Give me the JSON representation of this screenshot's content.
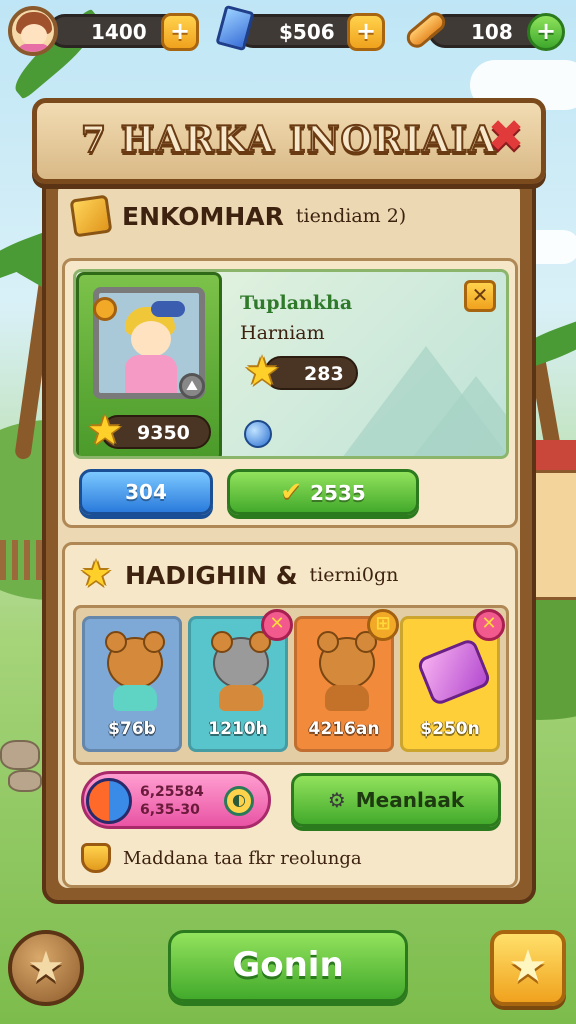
{
  "topbar": {
    "coins": "1400",
    "gems": "$506",
    "energy": "108",
    "plus": "+"
  },
  "header": {
    "title": "7 HARKA INORIAIA",
    "close": "✖"
  },
  "section1": {
    "title": "ENKOMHAR",
    "subtitle": "tiendiam 2)",
    "character": {
      "name": "Tuplankha",
      "role": "Harniam",
      "power": "9350",
      "stars": "283",
      "badge": "⛰",
      "corner": "✕"
    },
    "buttons": {
      "blue": "304",
      "green": "2535"
    }
  },
  "section2": {
    "title": "HADIGHIN &",
    "subtitle": "tierni0gn",
    "items": [
      {
        "price": "$76b",
        "color": "#7ea9d6"
      },
      {
        "price": "1210h",
        "color": "#58c4cc",
        "badge": "✕"
      },
      {
        "price": "4216an",
        "color": "#f28a3c",
        "badge": "⊞"
      },
      {
        "price": "$250n",
        "color": "#ffcf3a",
        "badge": "✕"
      }
    ],
    "gem_pill": {
      "line1": "6,25584",
      "line2": "6,35-30"
    },
    "meta_button": "Meanlaak",
    "note": "Maddana  taa  fkr  reolunga"
  },
  "footer": {
    "go": "Gonin",
    "left": "★",
    "right": "★"
  },
  "colors": {
    "wood": "#8b5a2b",
    "parchment": "#ecd9b4",
    "green_button": "#43aa2c",
    "blue_button": "#2a7bdc"
  },
  "icons": [
    "avatar",
    "gem-icon",
    "bandage-icon",
    "cube-icon",
    "star-icon",
    "close-icon",
    "potion-icon",
    "bear-icon"
  ]
}
